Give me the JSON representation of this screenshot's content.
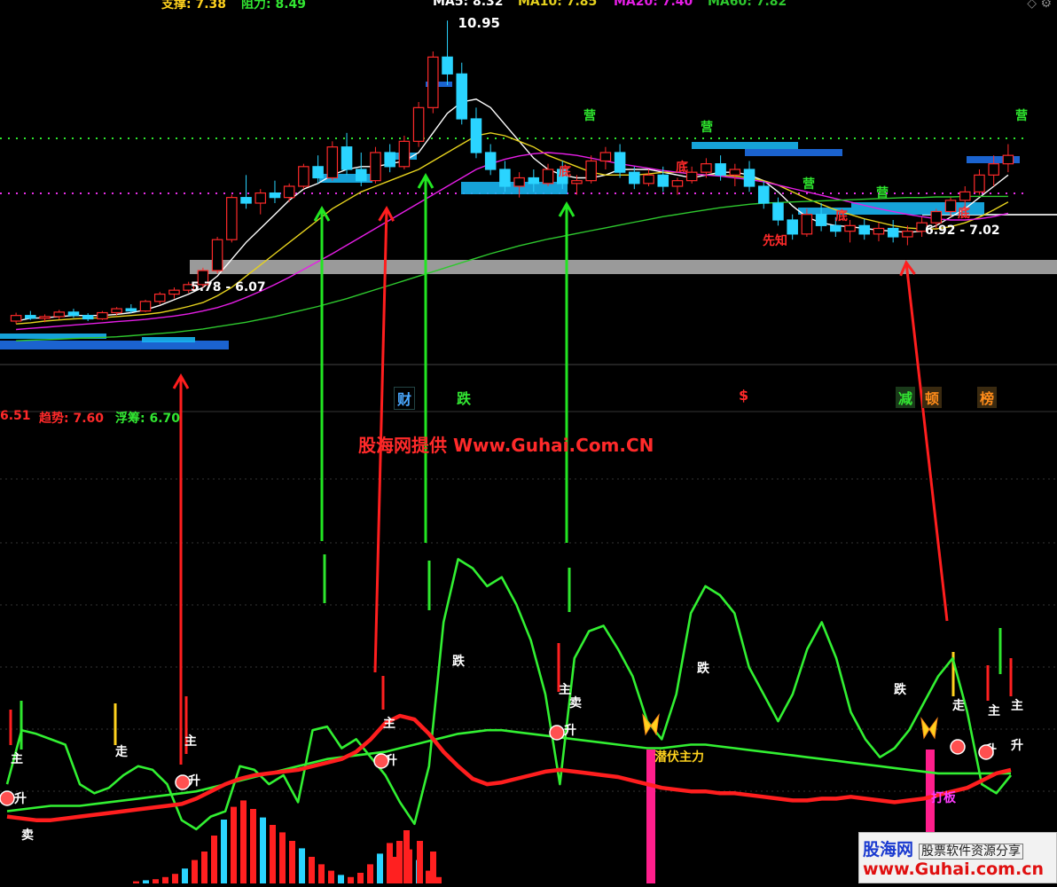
{
  "header": {
    "support_label": "支撑: 7.38",
    "resistance_label": "阻力: 8.49",
    "ma5": "MA5: 8.32",
    "ma10": "MA10: 7.85",
    "ma20": "MA20: 7.40",
    "ma60": "MA60: 7.82"
  },
  "indicator_header": {
    "value1": "6.51",
    "trend": "趋势: 7.60",
    "float_chip": "浮筹: 6.70"
  },
  "watermark": "股海网提供 Www.Guhai.Com.CN",
  "logo": {
    "line1": "股海网",
    "line1_tag": "股票软件资源分享",
    "line2": "www.Guhai.com.cn"
  },
  "signals": [
    {
      "text": "财",
      "color": "#4aa8ff"
    },
    {
      "text": "跌",
      "color": "#32e632"
    },
    {
      "text": "$",
      "color": "#ff2a2a"
    },
    {
      "text": "减",
      "color": "#32e632"
    },
    {
      "text": "顿",
      "color": "#ff8c1a"
    },
    {
      "text": "榜",
      "color": "#ff8c1a"
    }
  ],
  "colors": {
    "up": "#ff2a2a",
    "down": "#2ad4ff",
    "green_line": "#32f032",
    "red_line": "#ff1e1e",
    "ma5": "#ffffff",
    "ma10": "#e6d21e",
    "ma20": "#e61ee6",
    "ma60": "#2ec82e",
    "gray_band": "#9a9a9a"
  },
  "chart_data": [
    {
      "type": "candlestick",
      "title": "",
      "price_labels": [
        {
          "text": "10.95",
          "note": "peak high"
        },
        {
          "text": "5.78 - 6.07",
          "note": "support zone"
        },
        {
          "text": "6.92 - 7.02",
          "note": "support zone"
        }
      ],
      "marker_texts": [
        "营",
        "营",
        "营",
        "营",
        "营",
        "底",
        "底",
        "底",
        "底",
        "先知"
      ],
      "candles": [
        {
          "o": 5.6,
          "h": 5.75,
          "l": 5.55,
          "c": 5.7
        },
        {
          "o": 5.7,
          "h": 5.78,
          "l": 5.62,
          "c": 5.65
        },
        {
          "o": 5.65,
          "h": 5.72,
          "l": 5.58,
          "c": 5.68
        },
        {
          "o": 5.68,
          "h": 5.8,
          "l": 5.63,
          "c": 5.76
        },
        {
          "o": 5.76,
          "h": 5.82,
          "l": 5.66,
          "c": 5.7
        },
        {
          "o": 5.7,
          "h": 5.74,
          "l": 5.6,
          "c": 5.64
        },
        {
          "o": 5.64,
          "h": 5.78,
          "l": 5.62,
          "c": 5.75
        },
        {
          "o": 5.75,
          "h": 5.85,
          "l": 5.7,
          "c": 5.82
        },
        {
          "o": 5.82,
          "h": 5.9,
          "l": 5.74,
          "c": 5.78
        },
        {
          "o": 5.78,
          "h": 5.98,
          "l": 5.76,
          "c": 5.95
        },
        {
          "o": 5.95,
          "h": 6.12,
          "l": 5.9,
          "c": 6.08
        },
        {
          "o": 6.08,
          "h": 6.2,
          "l": 6.0,
          "c": 6.15
        },
        {
          "o": 6.15,
          "h": 6.3,
          "l": 6.1,
          "c": 6.25
        },
        {
          "o": 6.25,
          "h": 6.55,
          "l": 6.2,
          "c": 6.5
        },
        {
          "o": 6.5,
          "h": 7.1,
          "l": 6.45,
          "c": 7.05
        },
        {
          "o": 7.05,
          "h": 7.85,
          "l": 7.0,
          "c": 7.8
        },
        {
          "o": 7.8,
          "h": 8.2,
          "l": 7.6,
          "c": 7.7
        },
        {
          "o": 7.7,
          "h": 7.95,
          "l": 7.5,
          "c": 7.88
        },
        {
          "o": 7.88,
          "h": 8.1,
          "l": 7.7,
          "c": 7.8
        },
        {
          "o": 7.8,
          "h": 8.05,
          "l": 7.72,
          "c": 8.0
        },
        {
          "o": 8.0,
          "h": 8.4,
          "l": 7.95,
          "c": 8.35
        },
        {
          "o": 8.35,
          "h": 8.55,
          "l": 8.05,
          "c": 8.15
        },
        {
          "o": 8.15,
          "h": 8.8,
          "l": 8.1,
          "c": 8.7
        },
        {
          "o": 8.7,
          "h": 8.95,
          "l": 8.2,
          "c": 8.3
        },
        {
          "o": 8.3,
          "h": 8.6,
          "l": 8.0,
          "c": 8.1
        },
        {
          "o": 8.1,
          "h": 8.7,
          "l": 8.05,
          "c": 8.6
        },
        {
          "o": 8.6,
          "h": 8.75,
          "l": 8.25,
          "c": 8.35
        },
        {
          "o": 8.35,
          "h": 8.9,
          "l": 8.3,
          "c": 8.8
        },
        {
          "o": 8.8,
          "h": 9.5,
          "l": 8.7,
          "c": 9.4
        },
        {
          "o": 9.4,
          "h": 10.4,
          "l": 9.3,
          "c": 10.3
        },
        {
          "o": 10.3,
          "h": 10.95,
          "l": 9.8,
          "c": 10.0
        },
        {
          "o": 10.0,
          "h": 10.2,
          "l": 9.1,
          "c": 9.2
        },
        {
          "o": 9.2,
          "h": 9.4,
          "l": 8.5,
          "c": 8.6
        },
        {
          "o": 8.6,
          "h": 8.75,
          "l": 8.2,
          "c": 8.3
        },
        {
          "o": 8.3,
          "h": 8.45,
          "l": 7.9,
          "c": 8.0
        },
        {
          "o": 8.0,
          "h": 8.25,
          "l": 7.8,
          "c": 8.15
        },
        {
          "o": 8.15,
          "h": 8.3,
          "l": 7.9,
          "c": 8.05
        },
        {
          "o": 8.05,
          "h": 8.4,
          "l": 8.0,
          "c": 8.3
        },
        {
          "o": 8.3,
          "h": 8.45,
          "l": 7.95,
          "c": 8.05
        },
        {
          "o": 8.05,
          "h": 8.2,
          "l": 7.85,
          "c": 8.1
        },
        {
          "o": 8.1,
          "h": 8.55,
          "l": 8.05,
          "c": 8.45
        },
        {
          "o": 8.45,
          "h": 8.7,
          "l": 8.3,
          "c": 8.6
        },
        {
          "o": 8.6,
          "h": 8.75,
          "l": 8.15,
          "c": 8.25
        },
        {
          "o": 8.25,
          "h": 8.35,
          "l": 7.95,
          "c": 8.05
        },
        {
          "o": 8.05,
          "h": 8.3,
          "l": 8.0,
          "c": 8.2
        },
        {
          "o": 8.2,
          "h": 8.35,
          "l": 7.9,
          "c": 8.0
        },
        {
          "o": 8.0,
          "h": 8.15,
          "l": 7.85,
          "c": 8.1
        },
        {
          "o": 8.1,
          "h": 8.35,
          "l": 8.05,
          "c": 8.25
        },
        {
          "o": 8.25,
          "h": 8.5,
          "l": 8.15,
          "c": 8.4
        },
        {
          "o": 8.4,
          "h": 8.55,
          "l": 8.1,
          "c": 8.2
        },
        {
          "o": 8.2,
          "h": 8.4,
          "l": 8.0,
          "c": 8.3
        },
        {
          "o": 8.3,
          "h": 8.45,
          "l": 7.9,
          "c": 8.0
        },
        {
          "o": 8.0,
          "h": 8.1,
          "l": 7.6,
          "c": 7.7
        },
        {
          "o": 7.7,
          "h": 7.8,
          "l": 7.3,
          "c": 7.4
        },
        {
          "o": 7.4,
          "h": 7.5,
          "l": 7.05,
          "c": 7.15
        },
        {
          "o": 7.15,
          "h": 7.6,
          "l": 7.1,
          "c": 7.5
        },
        {
          "o": 7.5,
          "h": 7.7,
          "l": 7.2,
          "c": 7.3
        },
        {
          "o": 7.3,
          "h": 7.45,
          "l": 7.1,
          "c": 7.2
        },
        {
          "o": 7.2,
          "h": 7.4,
          "l": 7.0,
          "c": 7.3
        },
        {
          "o": 7.3,
          "h": 7.42,
          "l": 7.05,
          "c": 7.15
        },
        {
          "o": 7.15,
          "h": 7.35,
          "l": 7.02,
          "c": 7.25
        },
        {
          "o": 7.25,
          "h": 7.4,
          "l": 7.0,
          "c": 7.1
        },
        {
          "o": 7.1,
          "h": 7.3,
          "l": 6.95,
          "c": 7.2
        },
        {
          "o": 7.2,
          "h": 7.45,
          "l": 7.1,
          "c": 7.35
        },
        {
          "o": 7.35,
          "h": 7.6,
          "l": 7.25,
          "c": 7.55
        },
        {
          "o": 7.55,
          "h": 7.8,
          "l": 7.45,
          "c": 7.75
        },
        {
          "o": 7.75,
          "h": 8.0,
          "l": 7.6,
          "c": 7.9
        },
        {
          "o": 7.9,
          "h": 8.3,
          "l": 7.85,
          "c": 8.2
        },
        {
          "o": 8.2,
          "h": 8.55,
          "l": 8.0,
          "c": 8.4
        },
        {
          "o": 8.4,
          "h": 8.75,
          "l": 8.25,
          "c": 8.55
        }
      ],
      "ma_lines": {
        "MA5": [
          5.6,
          5.65,
          5.66,
          5.68,
          5.7,
          5.7,
          5.7,
          5.72,
          5.75,
          5.8,
          5.88,
          5.98,
          6.08,
          6.2,
          6.4,
          6.7,
          7.0,
          7.25,
          7.5,
          7.75,
          7.95,
          8.05,
          8.2,
          8.3,
          8.35,
          8.35,
          8.4,
          8.45,
          8.6,
          8.95,
          9.3,
          9.5,
          9.55,
          9.4,
          9.1,
          8.8,
          8.5,
          8.3,
          8.2,
          8.15,
          8.15,
          8.2,
          8.3,
          8.3,
          8.3,
          8.25,
          8.2,
          8.15,
          8.2,
          8.25,
          8.25,
          8.2,
          8.1,
          7.9,
          7.65,
          7.45,
          7.35,
          7.3,
          7.28,
          7.25,
          7.22,
          7.2,
          7.18,
          7.2,
          7.3,
          7.45,
          7.6,
          7.8,
          8.0,
          8.2
        ],
        "MA10": [
          5.55,
          5.57,
          5.6,
          5.62,
          5.64,
          5.65,
          5.66,
          5.68,
          5.7,
          5.72,
          5.75,
          5.8,
          5.86,
          5.93,
          6.05,
          6.2,
          6.4,
          6.6,
          6.8,
          7.0,
          7.2,
          7.4,
          7.6,
          7.75,
          7.9,
          8.0,
          8.1,
          8.2,
          8.3,
          8.45,
          8.6,
          8.75,
          8.9,
          8.95,
          8.9,
          8.8,
          8.7,
          8.55,
          8.45,
          8.35,
          8.25,
          8.2,
          8.2,
          8.2,
          8.22,
          8.25,
          8.25,
          8.22,
          8.2,
          8.2,
          8.18,
          8.15,
          8.1,
          8.02,
          7.9,
          7.78,
          7.68,
          7.58,
          7.5,
          7.42,
          7.36,
          7.3,
          7.26,
          7.24,
          7.24,
          7.28,
          7.35,
          7.45,
          7.58,
          7.72
        ],
        "MA20": [
          5.45,
          5.47,
          5.49,
          5.51,
          5.53,
          5.55,
          5.57,
          5.59,
          5.61,
          5.63,
          5.66,
          5.69,
          5.73,
          5.78,
          5.84,
          5.92,
          6.02,
          6.13,
          6.25,
          6.38,
          6.52,
          6.66,
          6.8,
          6.95,
          7.1,
          7.25,
          7.4,
          7.55,
          7.7,
          7.85,
          8.0,
          8.15,
          8.3,
          8.4,
          8.48,
          8.54,
          8.58,
          8.6,
          8.58,
          8.55,
          8.5,
          8.45,
          8.4,
          8.36,
          8.32,
          8.28,
          8.25,
          8.22,
          8.2,
          8.18,
          8.15,
          8.12,
          8.08,
          8.02,
          7.96,
          7.9,
          7.84,
          7.78,
          7.72,
          7.66,
          7.6,
          7.55,
          7.5,
          7.46,
          7.42,
          7.4,
          7.4,
          7.42,
          7.46,
          7.52
        ],
        "MA60": [
          5.25,
          5.26,
          5.27,
          5.28,
          5.29,
          5.3,
          5.31,
          5.32,
          5.34,
          5.36,
          5.38,
          5.4,
          5.43,
          5.46,
          5.5,
          5.54,
          5.58,
          5.63,
          5.68,
          5.74,
          5.8,
          5.86,
          5.93,
          6.0,
          6.08,
          6.16,
          6.24,
          6.32,
          6.4,
          6.48,
          6.56,
          6.64,
          6.72,
          6.8,
          6.87,
          6.94,
          7.0,
          7.06,
          7.11,
          7.16,
          7.21,
          7.26,
          7.31,
          7.36,
          7.41,
          7.46,
          7.5,
          7.54,
          7.58,
          7.62,
          7.65,
          7.68,
          7.7,
          7.71,
          7.72,
          7.73,
          7.74,
          7.75,
          7.76,
          7.77,
          7.78,
          7.79,
          7.8,
          7.8,
          7.81,
          7.81,
          7.82,
          7.82,
          7.82,
          7.82
        ]
      }
    },
    {
      "type": "line",
      "title": "",
      "labels": [
        {
          "text": "主"
        },
        {
          "text": "卖"
        },
        {
          "text": "走"
        },
        {
          "text": "升"
        },
        {
          "text": "主"
        },
        {
          "text": "升"
        },
        {
          "text": "主"
        },
        {
          "text": "升"
        },
        {
          "text": "跌"
        },
        {
          "text": "主"
        },
        {
          "text": "卖"
        },
        {
          "text": "升"
        },
        {
          "text": "潜伏主力"
        },
        {
          "text": "跌"
        },
        {
          "text": "跌"
        },
        {
          "text": "走"
        },
        {
          "text": "主"
        },
        {
          "text": "主"
        },
        {
          "text": "升"
        },
        {
          "text": "升"
        },
        {
          "text": "打板"
        }
      ],
      "series": [
        {
          "values": [
            30,
            60,
            58,
            55,
            52,
            30,
            25,
            28,
            35,
            40,
            38,
            30,
            10,
            5,
            12,
            15,
            40,
            38,
            30,
            35,
            20,
            60,
            62,
            50,
            55,
            45,
            35,
            20,
            8,
            40,
            120,
            155,
            150,
            140,
            145,
            130,
            110,
            80,
            30,
            100,
            115,
            118,
            105,
            90,
            65,
            55,
            80,
            125,
            140,
            135,
            125,
            95,
            80,
            65,
            80,
            105,
            120,
            100,
            70,
            55,
            45,
            50,
            60,
            75,
            90,
            100,
            70,
            30,
            25,
            35
          ]
        },
        {
          "values": [
            15,
            16,
            17,
            18,
            18,
            18,
            19,
            20,
            21,
            22,
            23,
            24,
            25,
            26,
            28,
            30,
            32,
            34,
            36,
            38,
            40,
            42,
            44,
            45,
            46,
            47,
            48,
            50,
            52,
            54,
            56,
            58,
            59,
            60,
            60,
            59,
            58,
            57,
            56,
            55,
            54,
            53,
            52,
            51,
            50,
            50,
            51,
            52,
            52,
            51,
            50,
            49,
            48,
            47,
            46,
            45,
            44,
            43,
            42,
            41,
            40,
            39,
            38,
            37,
            36,
            36,
            36,
            36,
            36,
            36
          ]
        },
        {
          "values": [
            12,
            11,
            10,
            10,
            11,
            12,
            13,
            14,
            15,
            16,
            17,
            18,
            19,
            22,
            26,
            30,
            33,
            35,
            36,
            37,
            38,
            40,
            42,
            44,
            48,
            55,
            64,
            68,
            66,
            58,
            48,
            40,
            33,
            30,
            31,
            33,
            35,
            37,
            38,
            37,
            36,
            35,
            34,
            32,
            30,
            28,
            27,
            26,
            26,
            25,
            25,
            24,
            23,
            22,
            21,
            21,
            22,
            22,
            23,
            22,
            21,
            20,
            21,
            22,
            24,
            26,
            28,
            32,
            36,
            38
          ]
        }
      ],
      "volume": [
        2,
        3,
        4,
        6,
        9,
        14,
        22,
        30,
        45,
        60,
        72,
        78,
        70,
        62,
        55,
        48,
        40,
        33,
        25,
        18,
        12,
        8,
        6,
        10,
        18,
        28,
        38,
        40,
        32,
        22,
        12,
        6
      ]
    }
  ]
}
